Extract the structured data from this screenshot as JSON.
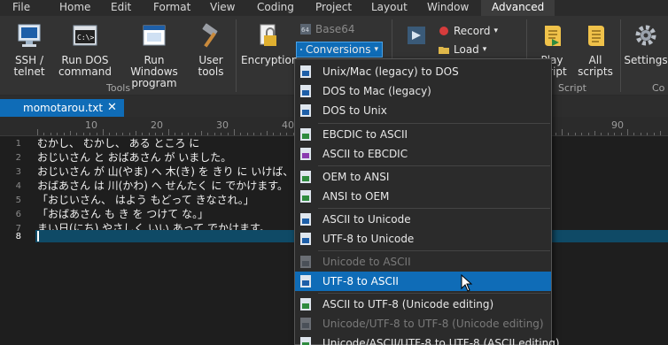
{
  "menu": {
    "items": [
      "File",
      "Home",
      "Edit",
      "Format",
      "View",
      "Coding",
      "Project",
      "Layout",
      "Window",
      "Advanced"
    ],
    "active": "Advanced"
  },
  "ribbon": {
    "ssh_label_1": "SSH /",
    "ssh_label_2": "telnet",
    "dos_label_1": "Run DOS",
    "dos_label_2": "command",
    "win_label_1": "Run Windows",
    "win_label_2": "program",
    "user_label_1": "User",
    "user_label_2": "tools",
    "tools_group": "Tools",
    "encryption_label": "Encryption",
    "base64_label": "Base64",
    "conversions_label": "Conversions",
    "group_a_partial": "A",
    "record_label": "Record",
    "load_label": "Load",
    "play_partial": "Play",
    "play_script_label_1": "Play",
    "play_script_label_2": "script",
    "all_scripts_label_1": "All",
    "all_scripts_label_2": "scripts",
    "script_group": "Script",
    "settings_label": "Settings",
    "co_group_partial": "Co"
  },
  "tab": {
    "filename": "momotarou.txt",
    "close": "✕"
  },
  "ruler": {
    "marks": [
      "10",
      "20",
      "30",
      "40"
    ]
  },
  "editor": {
    "line_numbers": [
      "1",
      "2",
      "3",
      "4",
      "5",
      "6",
      "7",
      "8"
    ],
    "lines": [
      "むかし、 むかし、 ある ところ に",
      "おじいさん と おばあさん が いました。",
      "おじいさん が 山(やま) へ 木(き) を きり に いけば、",
      "おばあさん は 川(かわ) へ せんたく に でかけます。",
      "「おじいさん、 はよう もどって きなされ。」",
      "「おばあさん も き を つけて な。」",
      "まい日(にち) やさしく いい あって でかけます。",
      ""
    ]
  },
  "conversions_menu": {
    "items": [
      {
        "label": "Unix/Mac (legacy) to DOS",
        "enabled": true
      },
      {
        "label": "DOS to Mac (legacy)",
        "enabled": true
      },
      {
        "label": "DOS to Unix",
        "enabled": true
      },
      {
        "label": "EBCDIC to ASCII",
        "enabled": true
      },
      {
        "label": "ASCII to EBCDIC",
        "enabled": true
      },
      {
        "label": "OEM to ANSI",
        "enabled": true
      },
      {
        "label": "ANSI to OEM",
        "enabled": true
      },
      {
        "label": "ASCII to Unicode",
        "enabled": true
      },
      {
        "label": "UTF-8 to Unicode",
        "enabled": true
      },
      {
        "label": "Unicode to ASCII",
        "enabled": false
      },
      {
        "label": "UTF-8 to ASCII",
        "enabled": true,
        "selected": true
      },
      {
        "label": "ASCII to UTF-8 (Unicode editing)",
        "enabled": true
      },
      {
        "label": "Unicode/UTF-8 to UTF-8 (Unicode editing)",
        "enabled": false
      },
      {
        "label": "Unicode/ASCII/UTF-8 to UTF-8 (ASCII editing)",
        "enabled": true
      }
    ]
  },
  "colors": {
    "accent": "#0f6cb7",
    "background": "#1e1e1e",
    "ribbon": "#333333",
    "current_line": "#0f4a66"
  }
}
